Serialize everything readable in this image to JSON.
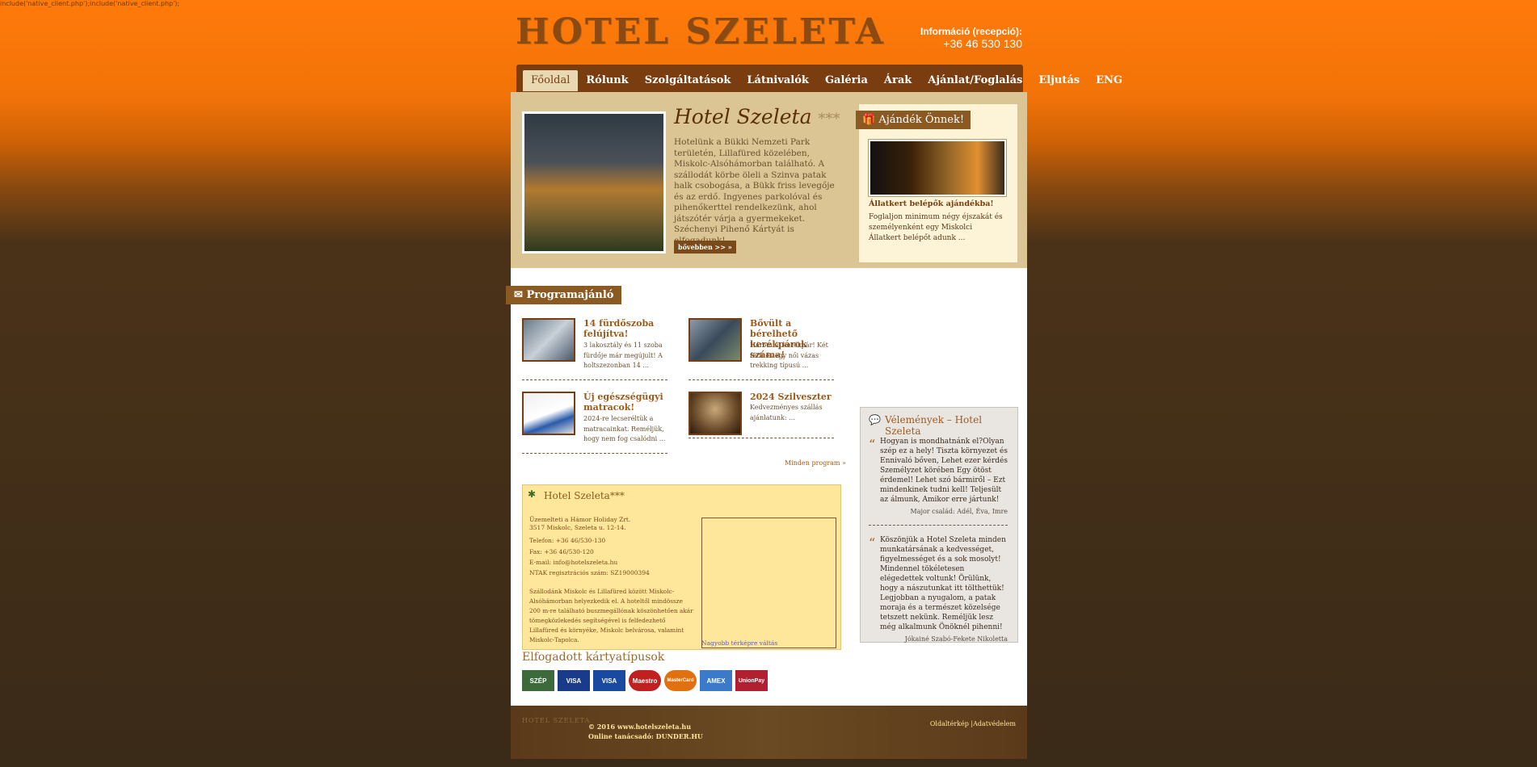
{
  "php_error": "include('native_client.php');include('native_client.php');",
  "header": {
    "logo": "HOTEL SZELETA",
    "info_label": "Információ (recepció):",
    "phone": "+36 46 530 130"
  },
  "nav": {
    "items": [
      {
        "label": "Főoldal",
        "active": true
      },
      {
        "label": "Rólunk"
      },
      {
        "label": "Szolgáltatások"
      },
      {
        "label": "Látnivalók"
      },
      {
        "label": "Galéria"
      },
      {
        "label": "Árak"
      },
      {
        "label": "Ajánlat/Foglalás"
      },
      {
        "label": "Eljutás"
      },
      {
        "label": "ENG"
      }
    ]
  },
  "hero": {
    "title": "Hotel Szeleta",
    "stars": "***",
    "text": "Hotelünk a Bükki Nemzeti Park területén, Lillafüred közelében, Miskolc-Alsóhámorban található. A szállodát körbe öleli a Szinva patak halk csobogása, a Bükk friss levegője és az erdő. Ingyenes parkolóval és pihenőkerttel rendelkezünk, ahol játszótér várja a gyermekeket. Széchenyi Pihenő Kártyát is elfogadunk!",
    "more": "bővebben >> »"
  },
  "gift": {
    "tab": "Ajándék Önnek!",
    "title": "Állatkert belépők ajándékba!",
    "text": "Foglaljon minimum négy éjszakát és személyenként egy Miskolci Állatkert belépőt adunk ..."
  },
  "programs": {
    "heading": "Programajánló",
    "items": [
      {
        "title": "14 fürdőszoba felújítva!",
        "desc": "3 lakosztály és 11 szoba fürdője már megújult! A holtszezonban 14 ..."
      },
      {
        "title": "Bővült a bérelhető kerékpárok száma!",
        "desc": "Három új kerékpár! Két férfi és egy női vázas trekking típusú ..."
      },
      {
        "title": "Új egészségügyi matracok!",
        "desc": "2024-re lecseréltük a matracainkat. Reméljük, hogy nem fog csalódni ..."
      },
      {
        "title": "2024 Szilveszter",
        "desc": "Kedvezményes szállás ajánlatunk: ..."
      }
    ],
    "all": "Minden program »"
  },
  "contact": {
    "title": "Hotel Szeleta***",
    "operator": "Üzemelteti a Hámor Holiday Zrt.",
    "address": "3517 Miskolc, Szeleta u. 12-14.",
    "phone": "Telefon: +36 46/530-130",
    "fax": "Fax: +36 46/530-120",
    "email": "E-mail: info@hotelszeleta.hu",
    "ntak": "NTAK regisztrációs szám: SZ19000394",
    "para": "Szállodánk Miskolc és Lillafüred között Miskolc-Alsóhámorban helyezkedik el. A hoteltől mindössze 200 m-re található buszmegállónak köszönhetően akár tömegközlekedés segítségével is felfedezhető Lillafüred és környéke, Miskolc belvárosa, valamint Miskolc-Tapolca.",
    "map_link": "Nagyobb térképre váltás"
  },
  "cards": {
    "heading": "Elfogadott kártyatípusok",
    "items": [
      {
        "name": "SZÉP",
        "color": "#3c6a3a"
      },
      {
        "name": "VISA",
        "color": "#1a3a8a"
      },
      {
        "name": "VISA",
        "color": "#1a4aa0"
      },
      {
        "name": "Maestro",
        "color": "#c02020"
      },
      {
        "name": "MasterCard",
        "color": "#e07010"
      },
      {
        "name": "AMEX",
        "color": "#3a7ac8"
      },
      {
        "name": "UnionPay",
        "color": "#b02030"
      }
    ]
  },
  "reviews": {
    "title": "Vélemények – Hotel Szeleta",
    "items": [
      {
        "text": "Hogyan is mondhatnánk el?Olyan szép ez a hely! Tiszta környezet és Ennivaló bőven, Lehet ezer kérdés Személyzet körében Egy ötöst érdemel! Lehet szó bármiről – Ezt mindenkinek tudni kell! Teljesült az álmunk, Amikor erre jártunk!",
        "author": "Major család: Adél, Éva, Imre"
      },
      {
        "text": "Köszönjük a Hotel Szeleta minden munkatársának a kedvességet, figyelmességet és a sok mosolyt! Mindennel tökéletesen elégedettek voltunk! Örülünk, hogy a nászutunkat itt tölthettük! Legjobban a nyugalom, a patak moraja és a természet közelsége tetszett nekünk. Reméljük lesz még alkalmunk Önöknél pihenni!",
        "author": "Jókainé Szabó-Fekete Nikoletta"
      }
    ]
  },
  "footer": {
    "logo": "HOTEL SZELETA",
    "copyright": "© 2016 www.hotelszeleta.hu",
    "credit": "Online tanácsadó: DUNDER.HU",
    "sitemap": "Oldaltérkép",
    "privacy": "Adatvédelem"
  }
}
